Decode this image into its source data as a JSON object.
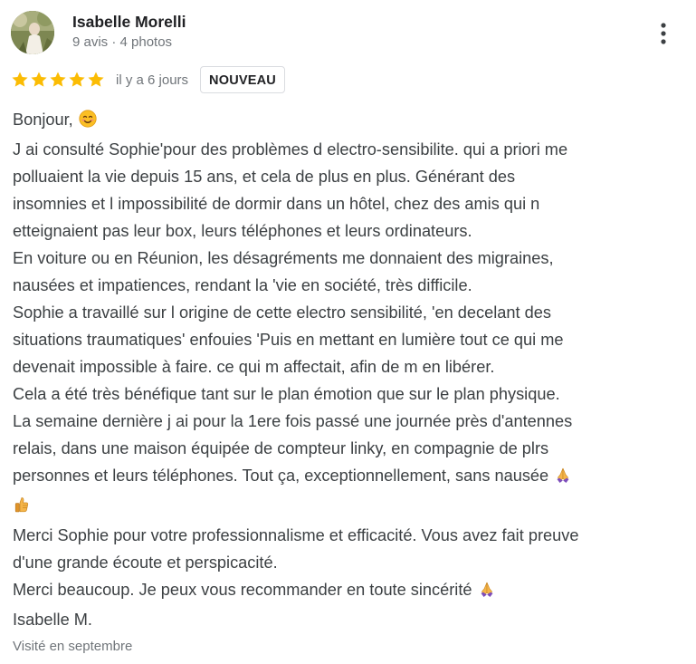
{
  "reviewer": {
    "name": "Isabelle Morelli",
    "meta": "9 avis · 4 photos"
  },
  "rating": {
    "stars": 5,
    "star_color": "#fbbc04",
    "relative_time": "il y a 6 jours",
    "badge": "NOUVEAU"
  },
  "review": {
    "lines": [
      "Bonjour,",
      "J ai consulté Sophie'pour des problèmes d electro-sensibilite. qui a priori me",
      "polluaient la vie depuis 15 ans, et cela de plus en plus. Générant des",
      "insomnies et l impossibilité de dormir dans un hôtel, chez des amis qui n",
      "etteignaient pas leur box, leurs téléphones et leurs ordinateurs.",
      "En voiture ou en Réunion, les désagréments me donnaient des migraines,",
      "nausées et impatiences, rendant la 'vie en société, très difficile.",
      "Sophie a travaillé sur l origine de cette electro sensibilité, 'en decelant des",
      "situations traumatiques' enfouies 'Puis en mettant en lumière tout ce qui me",
      "devenait impossible à faire. ce qui m affectait, afin de m en libérer.",
      "Cela a été très bénéfique tant sur le plan émotion que sur le plan physique.",
      "La semaine dernière j ai pour la 1ere fois passé une journée près d'antennes",
      "relais, dans une maison équipée de compteur linky, en compagnie de plrs",
      "personnes et leurs téléphones. Tout ça, exceptionnellement, sans nausée",
      "",
      "Merci Sophie pour votre professionnalisme et efficacité. Vous avez fait preuve",
      "d'une grande écoute et perspicacité.",
      "Merci beaucoup. Je peux vous recommander en toute sincérité",
      "Isabelle M."
    ],
    "emoji_icons": {
      "line_0": "smiling-face-emoji",
      "line_13": "folded-hands-emoji",
      "line_14": "thumbs-up-emoji",
      "line_17": "folded-hands-emoji"
    }
  },
  "visit": {
    "note": "Visité en septembre"
  }
}
